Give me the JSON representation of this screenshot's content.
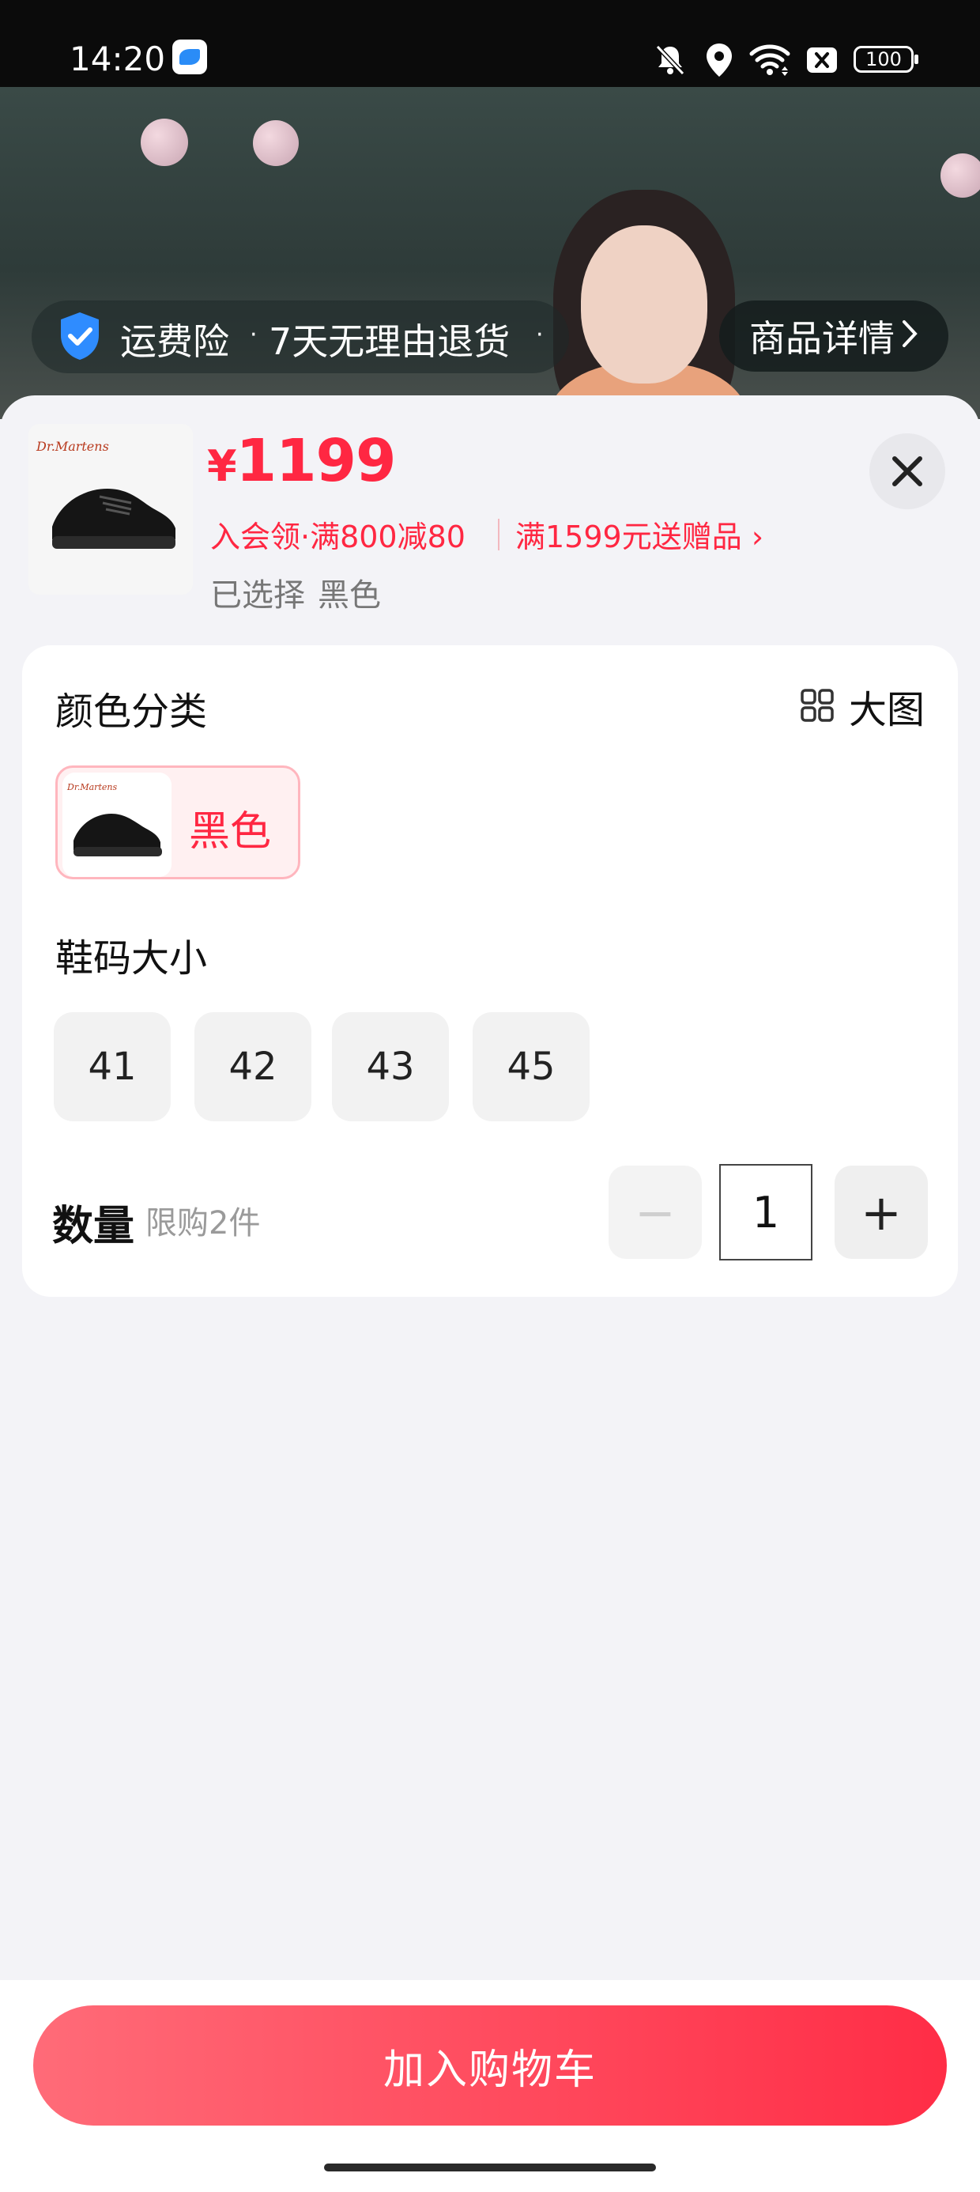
{
  "status_bar": {
    "time": "14:20",
    "battery": "100",
    "icons": [
      "app-notification-icon",
      "mute-bell-icon",
      "location-icon",
      "wifi-icon",
      "no-sim-icon",
      "battery-icon"
    ]
  },
  "hero": {
    "shipping_insurance": "运费险",
    "return_policy": "7天无理由退货",
    "detail_button": "商品详情"
  },
  "product": {
    "price_symbol": "¥",
    "price": "1199",
    "promo_member": "入会领·满800减80",
    "promo_gift": "满1599元送赠品",
    "selected_label": "已选择",
    "selected_value": "黑色"
  },
  "color_section": {
    "title": "颜色分类",
    "big_view_label": "大图",
    "options": [
      {
        "label": "黑色",
        "selected": true
      }
    ]
  },
  "size_section": {
    "title": "鞋码大小",
    "sizes": [
      "41",
      "42",
      "43",
      "45"
    ]
  },
  "quantity": {
    "label": "数量",
    "limit": "限购2件",
    "minus": "−",
    "value": "1",
    "plus": "+"
  },
  "cart_button": "加入购物车",
  "colors": {
    "accent": "#ff2742",
    "selected_bg": "#fff0f1",
    "selected_border": "#ffb6be"
  }
}
